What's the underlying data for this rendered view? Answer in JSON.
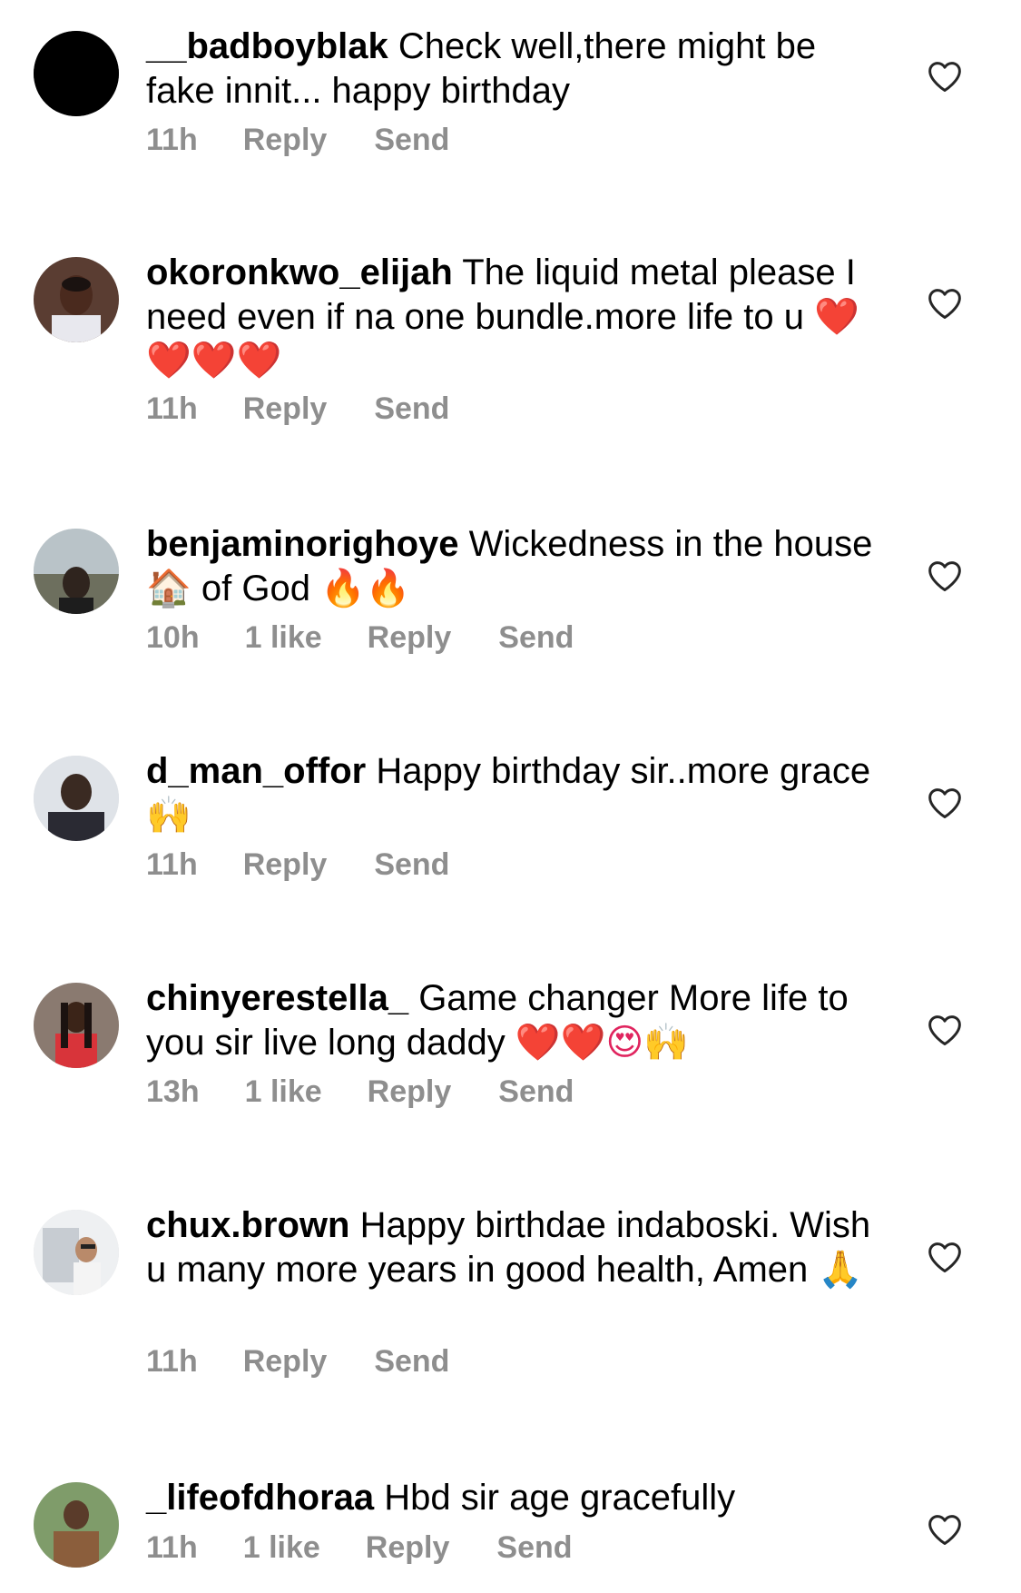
{
  "comments": [
    {
      "username": "__badboyblak",
      "text": "Check well,there might be fake innit... happy birthday",
      "emoji": "",
      "time": "11h",
      "likes": "",
      "reply_label": "Reply",
      "send_label": "Send"
    },
    {
      "username": "okoronkwo_elijah",
      "text": "The liquid metal please I need even if na one bundle.more life to u",
      "emoji": "❤️❤️❤️❤️",
      "time": "11h",
      "likes": "",
      "reply_label": "Reply",
      "send_label": "Send"
    },
    {
      "username": "benjaminorighoye",
      "text": "Wickedness in the house 🏠 of God",
      "emoji": "🔥🔥",
      "time": "10h",
      "likes": "1 like",
      "reply_label": "Reply",
      "send_label": "Send"
    },
    {
      "username": "d_man_offor",
      "text": "Happy birthday sir..more grace",
      "emoji": "🙌",
      "time": "11h",
      "likes": "",
      "reply_label": "Reply",
      "send_label": "Send"
    },
    {
      "username": "chinyerestella_",
      "text": "Game changer More life to you sir live long daddy",
      "emoji": "❤️❤️😍🙌",
      "time": "13h",
      "likes": "1 like",
      "reply_label": "Reply",
      "send_label": "Send"
    },
    {
      "username": "chux.brown",
      "text": "Happy birthdae indaboski. Wish u many more years in good health, Amen",
      "emoji": "🙏",
      "time": "11h",
      "likes": "",
      "reply_label": "Reply",
      "send_label": "Send"
    },
    {
      "username": "_lifeofdhoraa",
      "text": "Hbd sir age gracefully",
      "emoji": "",
      "time": "11h",
      "likes": "1 like",
      "reply_label": "Reply",
      "send_label": "Send"
    }
  ],
  "colors": {
    "text": "#000000",
    "meta": "#8e8e8e",
    "heart_outline": "#262626",
    "heart_emoji": "#e0245e"
  },
  "icons": {
    "like": "heart-outline-icon"
  }
}
